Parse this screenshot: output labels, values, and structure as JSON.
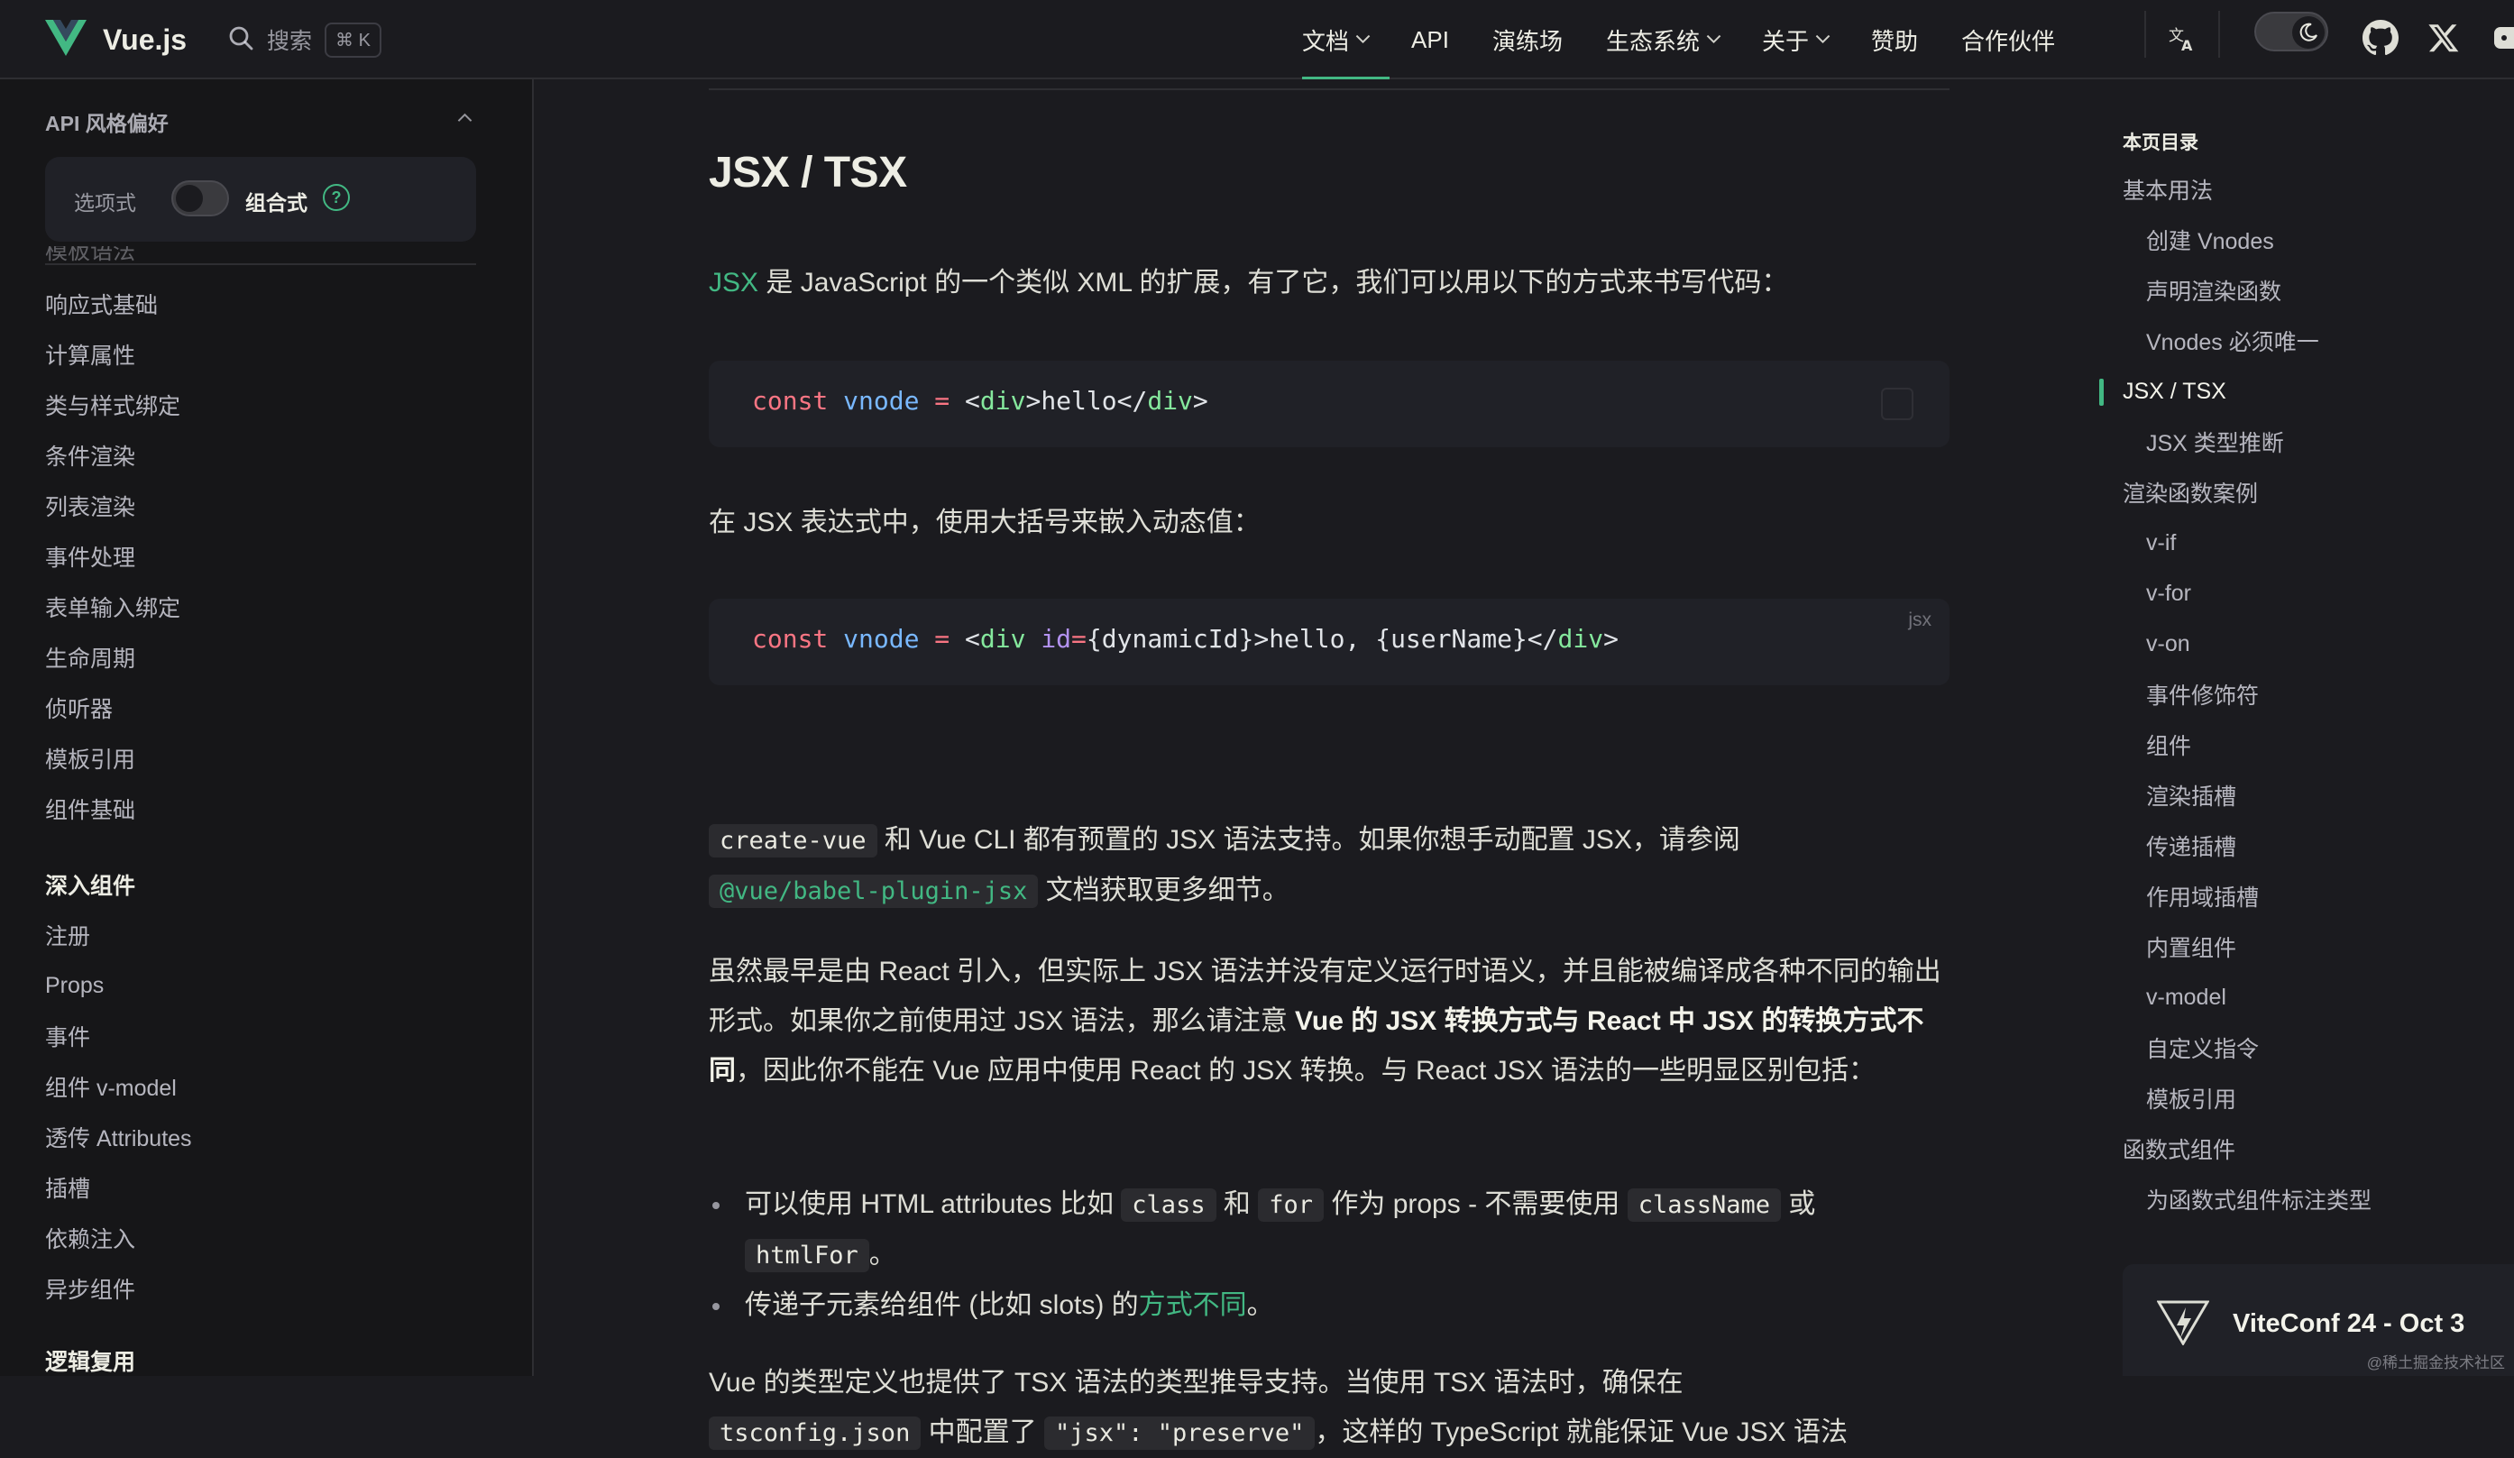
{
  "nav": {
    "brand": "Vue.js",
    "search_label": "搜索",
    "search_shortcut": "⌘ K",
    "links": [
      "文档",
      "API",
      "演练场",
      "生态系统",
      "关于",
      "赞助",
      "合作伙伴"
    ],
    "active_link": "文档"
  },
  "sidebar": {
    "pref_title": "API 风格偏好",
    "pref_option_a": "选项式",
    "pref_option_b": "组合式",
    "pref_help": "?",
    "partial_item": "模板语法",
    "items_a": [
      "响应式基础",
      "计算属性",
      "类与样式绑定",
      "条件渲染",
      "列表渲染",
      "事件处理",
      "表单输入绑定",
      "生命周期",
      "侦听器",
      "模板引用",
      "组件基础"
    ],
    "group_b": "深入组件",
    "items_b": [
      "注册",
      "Props",
      "事件",
      "组件 v-model",
      "透传 Attributes",
      "插槽",
      "依赖注入",
      "异步组件"
    ],
    "group_c": "逻辑复用"
  },
  "content": {
    "title": "JSX / TSX",
    "p1_link": "JSX",
    "p1_rest": " 是 JavaScript 的一个类似 XML 的扩展，有了它，我们可以用以下的方式来书写代码：",
    "code1": {
      "kw": "const",
      "var": "vnode",
      "op": " = ",
      "open_lt": "<",
      "tag": "div",
      "gt": ">",
      "text": "hello",
      "close_lt": "</",
      "close_tag": "div",
      "close_gt": ">"
    },
    "p2": "在 JSX 表达式中，使用大括号来嵌入动态值：",
    "code2": {
      "kw": "const",
      "var": "vnode",
      "op": " = ",
      "open_lt": "<",
      "tag": "div",
      "attr": " id",
      "eq": "=",
      "expr": "{dynamicId}",
      "gt": ">",
      "text": "hello, {userName}",
      "close_lt": "</",
      "close_tag": "div",
      "close_gt": ">",
      "lang": "jsx"
    },
    "p3_code1": "create-vue",
    "p3_text1": " 和 Vue CLI 都有预置的 JSX 语法支持。如果你想手动配置 JSX，请参阅",
    "p3_code2": "@vue/babel-plugin-jsx",
    "p3_text2": " 文档获取更多细节。",
    "p4_text1": "虽然最早是由 React 引入，但实际上 JSX 语法并没有定义运行时语义，并且能被编译成各种不同的输出形式。如果你之前使用过 JSX 语法，那么请注意 ",
    "p4_bold": "Vue 的 JSX 转换方式与 React 中 JSX 的转换方式不同",
    "p4_text2": "，因此你不能在 Vue 应用中使用 React 的 JSX 转换。与 React JSX 语法的一些明显区别包括：",
    "b1_text1": "可以使用 HTML attributes 比如 ",
    "b1_code1": "class",
    "b1_text2": " 和 ",
    "b1_code2": "for",
    "b1_text3": " 作为 props - 不需要使用 ",
    "b1_code3": "className",
    "b1_text4": " 或 ",
    "b1_code4": "htmlFor",
    "b1_text5": "。",
    "b2_text1": "传递子元素给组件 (比如 slots) 的",
    "b2_link": "方式不同",
    "b2_text2": "。",
    "p5_text1": "Vue 的类型定义也提供了 TSX 语法的类型推导支持。当使用 TSX 语法时，确保在",
    "p5_code1": "tsconfig.json",
    "p5_text2": " 中配置了 ",
    "p5_code2": "\"jsx\": \"preserve\"",
    "p5_text3": "，这样的 TypeScript 就能保证 Vue JSX 语法"
  },
  "toc": {
    "title": "本页目录",
    "items": [
      {
        "label": "基本用法",
        "level": 1
      },
      {
        "label": "创建 Vnodes",
        "level": 2
      },
      {
        "label": "声明渲染函数",
        "level": 2
      },
      {
        "label": "Vnodes 必须唯一",
        "level": 2
      },
      {
        "label": "JSX / TSX",
        "level": 1,
        "active": true
      },
      {
        "label": "JSX 类型推断",
        "level": 2
      },
      {
        "label": "渲染函数案例",
        "level": 1
      },
      {
        "label": "v-if",
        "level": 2
      },
      {
        "label": "v-for",
        "level": 2
      },
      {
        "label": "v-on",
        "level": 2
      },
      {
        "label": "事件修饰符",
        "level": 2
      },
      {
        "label": "组件",
        "level": 2
      },
      {
        "label": "渲染插槽",
        "level": 2
      },
      {
        "label": "传递插槽",
        "level": 2
      },
      {
        "label": "作用域插槽",
        "level": 2
      },
      {
        "label": "内置组件",
        "level": 2
      },
      {
        "label": "v-model",
        "level": 2
      },
      {
        "label": "自定义指令",
        "level": 2
      },
      {
        "label": "模板引用",
        "level": 2
      },
      {
        "label": "函数式组件",
        "level": 1
      },
      {
        "label": "为函数式组件标注类型",
        "level": 2
      }
    ]
  },
  "promo": {
    "text": "ViteConf 24 - Oct 3"
  },
  "watermark": "@稀土掘金技术社区",
  "colors": {
    "accent": "#42b883",
    "background": "#1b1b1f",
    "sidebar": "#161618",
    "code_bg": "#202127"
  }
}
